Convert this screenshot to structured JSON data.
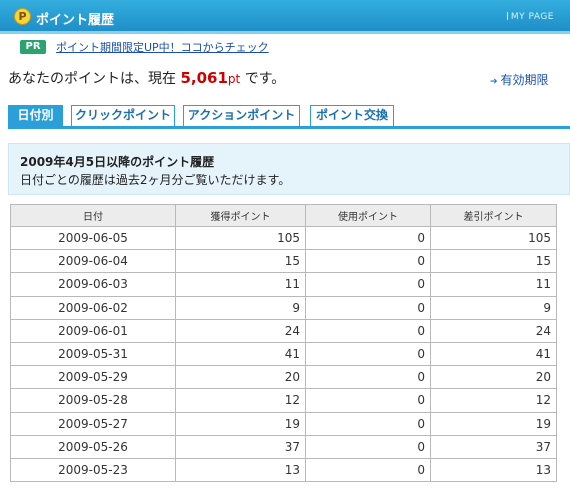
{
  "header": {
    "icon": "point-p-icon",
    "title": "ポイント履歴",
    "mypage_label": "MY PAGE"
  },
  "pr": {
    "badge": "PR",
    "link": "ポイント期間限定UP中！ココからチェック"
  },
  "points": {
    "prefix": "あなたのポイントは、現在",
    "value": "5,061",
    "unit": "pt",
    "suffix": "です。",
    "expiry_link": "有効期限"
  },
  "tabs": [
    {
      "label": "日付別",
      "active": true
    },
    {
      "label": "クリックポイント",
      "active": false
    },
    {
      "label": "アクションポイント",
      "active": false
    },
    {
      "label": "ポイント交換",
      "active": false
    }
  ],
  "info": {
    "heading": "2009年4月5日以降のポイント履歴",
    "subtext": "日付ごとの履歴は過去2ヶ月分ご覧いただけます。"
  },
  "table": {
    "columns": [
      "日付",
      "獲得ポイント",
      "使用ポイント",
      "差引ポイント"
    ],
    "rows": [
      [
        "2009-06-05",
        "105",
        "0",
        "105"
      ],
      [
        "2009-06-04",
        "15",
        "0",
        "15"
      ],
      [
        "2009-06-03",
        "11",
        "0",
        "11"
      ],
      [
        "2009-06-02",
        "9",
        "0",
        "9"
      ],
      [
        "2009-06-01",
        "24",
        "0",
        "24"
      ],
      [
        "2009-05-31",
        "41",
        "0",
        "41"
      ],
      [
        "2009-05-29",
        "20",
        "0",
        "20"
      ],
      [
        "2009-05-28",
        "12",
        "0",
        "12"
      ],
      [
        "2009-05-27",
        "19",
        "0",
        "19"
      ],
      [
        "2009-05-26",
        "37",
        "0",
        "37"
      ],
      [
        "2009-05-23",
        "13",
        "0",
        "13"
      ]
    ]
  },
  "colors": {
    "header_blue": "#2a9fd8",
    "points_red": "#cc0000",
    "link_blue": "#1a4fb0",
    "pr_green": "#2aa36e",
    "info_bg": "#e5f3fb"
  }
}
